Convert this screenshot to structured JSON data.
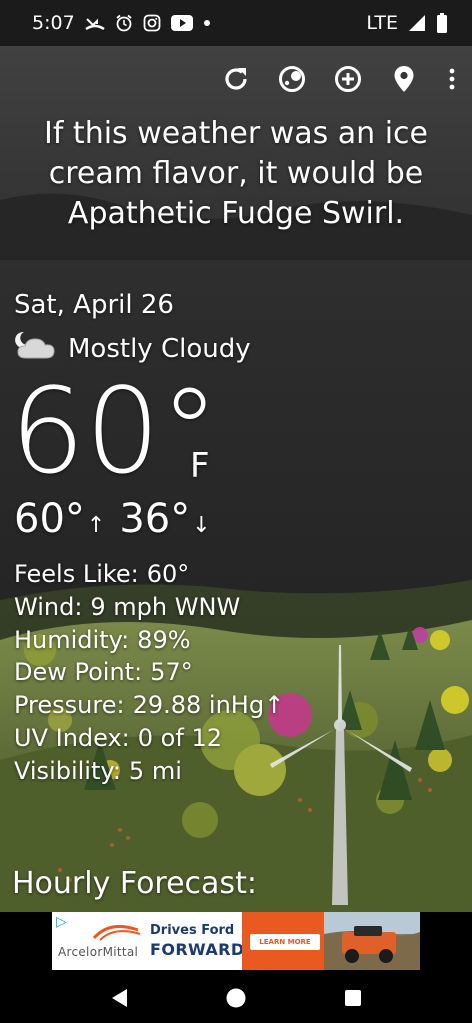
{
  "status_bar": {
    "time": "5:07",
    "network": "LTE",
    "icons": [
      "missed-call-icon",
      "alarm-icon",
      "instagram-icon",
      "youtube-icon",
      "dot-icon",
      "signal-icon",
      "battery-icon"
    ]
  },
  "toolbar": {
    "buttons": [
      "refresh-icon",
      "theme-icon",
      "add-location-icon",
      "location-pin-icon",
      "more-options-icon"
    ]
  },
  "headline": "If this weather was an ice cream flavor, it would be Apathetic Fudge Swirl.",
  "current": {
    "date": "Sat, April 26",
    "condition": "Mostly Cloudy",
    "condition_icon": "partly-cloudy-night-icon",
    "temperature": "60°",
    "unit": "F",
    "high": "60°",
    "low": "36°",
    "high_arrow": "↑",
    "low_arrow": "↓"
  },
  "details": [
    {
      "label": "Feels Like:",
      "value": "60°"
    },
    {
      "label": "Wind:",
      "value": "9 mph WNW"
    },
    {
      "label": "Humidity:",
      "value": "89%"
    },
    {
      "label": "Dew Point:",
      "value": "57°"
    },
    {
      "label": "Pressure:",
      "value": "29.88 inHg↑"
    },
    {
      "label": "UV Index:",
      "value": "0 of 12"
    },
    {
      "label": "Visibility:",
      "value": "5 mi"
    }
  ],
  "hourly_title": "Hourly Forecast:",
  "ad": {
    "brand": "ArcelorMittal",
    "line1": "Drives Ford",
    "line2": "FORWARD.",
    "cta": "LEARN MORE",
    "choices_icon": "▷"
  },
  "nav": [
    "back-icon",
    "home-icon",
    "recents-icon"
  ],
  "colors": {
    "sky_top": "#3f3f3f",
    "sky_bottom": "#1f1f1f",
    "hills": "#5e6e3a",
    "ad_orange": "#ea5a20",
    "ad_navy": "#1c3a6e"
  }
}
